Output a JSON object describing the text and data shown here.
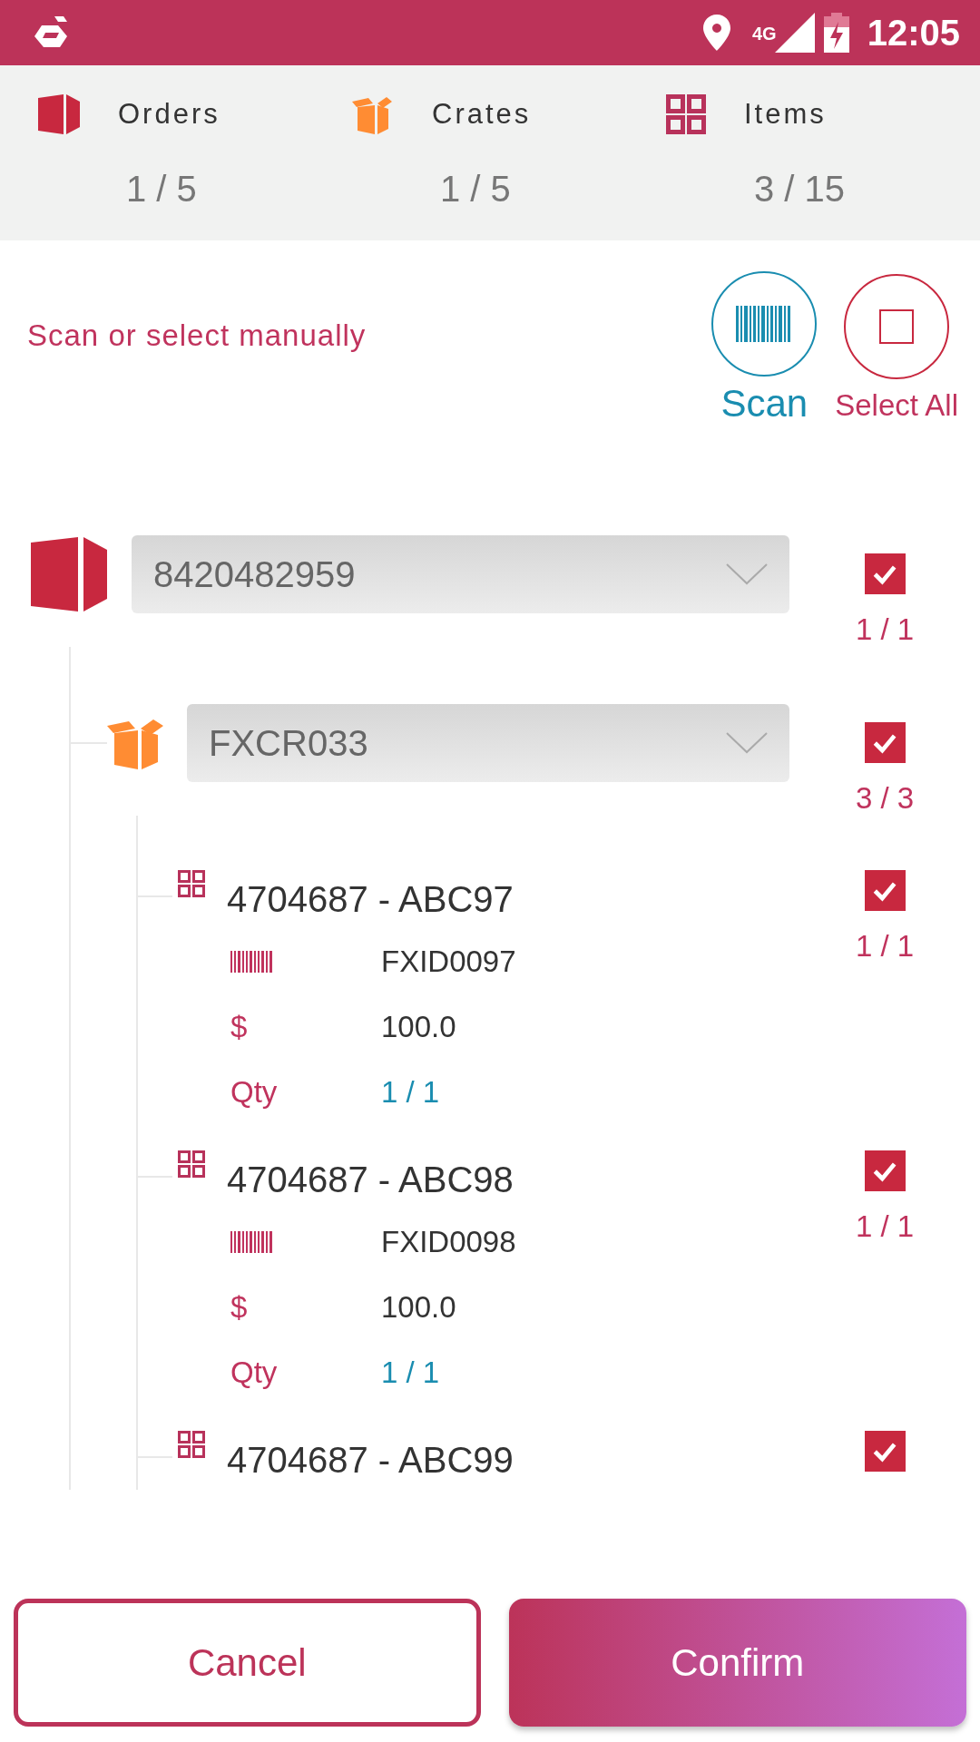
{
  "status_bar": {
    "network": "4G",
    "time": "12:05"
  },
  "summary": [
    {
      "kind": "order",
      "label": "Orders",
      "count": "1 / 5"
    },
    {
      "kind": "crate",
      "label": "Crates",
      "count": "1 / 5"
    },
    {
      "kind": "item",
      "label": "Items",
      "count": "3 / 15"
    }
  ],
  "prompt": "Scan or select manually",
  "actions": [
    {
      "kind": "scan",
      "label": "Scan"
    },
    {
      "kind": "select_all",
      "label": "Select All",
      "checked": false
    }
  ],
  "order": {
    "value": "8420482959",
    "checked": true,
    "count": "1 / 1",
    "crate": {
      "value": "FXCR033",
      "checked": true,
      "count": "3 / 3",
      "items": [
        {
          "title": "4704687 - ABC97",
          "checked": true,
          "count": "1 / 1",
          "barcode": "FXID0097",
          "price_label": "$",
          "price": "100.0",
          "qty_label": "Qty",
          "qty": "1 / 1"
        },
        {
          "title": "4704687 - ABC98",
          "checked": true,
          "count": "1 / 1",
          "barcode": "FXID0098",
          "price_label": "$",
          "price": "100.0",
          "qty_label": "Qty",
          "qty": "1 / 1"
        },
        {
          "title": "4704687 - ABC99",
          "checked": true
        }
      ]
    }
  },
  "buttons": [
    {
      "kind": "cancel",
      "label": "Cancel"
    },
    {
      "kind": "confirm",
      "label": "Confirm"
    }
  ]
}
